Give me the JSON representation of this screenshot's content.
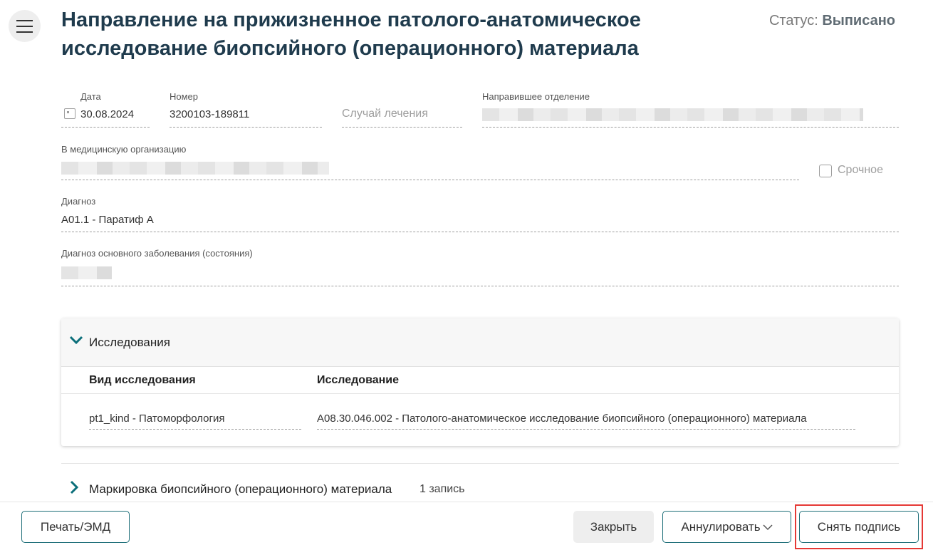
{
  "header": {
    "title_line1": "Направление на прижизненное патолого-анатомическое",
    "title_line2": "исследование биопсийного (операционного) материала",
    "status_label": "Статус:",
    "status_value": "Выписано"
  },
  "form": {
    "date_label": "Дата",
    "date_value": "30.08.2024",
    "number_label": "Номер",
    "number_value": "3200103-189811",
    "case_placeholder": "Случай лечения",
    "dept_label": "Направившее отделение",
    "org_label": "В медицинскую организацию",
    "urgent_label": "Срочное",
    "diagnosis_label": "Диагноз",
    "diagnosis_value": "A01.1 - Паратиф A",
    "main_diagnosis_label": "Диагноз основного заболевания (состояния)"
  },
  "research": {
    "section_title": "Исследования",
    "col_kind": "Вид исследования",
    "col_research": "Исследование",
    "rows": [
      {
        "kind": "pt1_kind - Патоморфология",
        "research": "A08.30.046.002 - Патолого-анатомическое исследование биопсийного (операционного) материала"
      }
    ]
  },
  "marking": {
    "section_title": "Маркировка биопсийного (операционного) материала",
    "count": "1 запись"
  },
  "footer": {
    "print_label": "Печать/ЭМД",
    "close_label": "Закрыть",
    "annul_label": "Аннулировать",
    "unsign_label": "Снять подпись"
  },
  "colors": {
    "accent": "#1d6e78",
    "highlight": "#e53935"
  }
}
